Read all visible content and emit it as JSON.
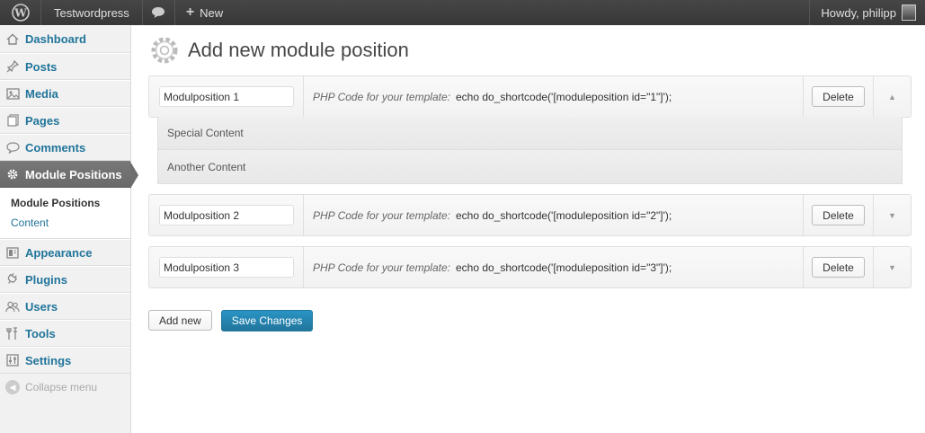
{
  "adminbar": {
    "wp_icon": "wordpress-logo-icon",
    "site_name": "Testwordpress",
    "comments_icon": "speech-bubble-icon",
    "new_icon": "plus-icon",
    "new_label": "New",
    "howdy": "Howdy, philipp"
  },
  "sidebar": {
    "items": [
      {
        "label": "Dashboard",
        "icon": "home-icon"
      },
      {
        "label": "Posts",
        "icon": "pin-icon"
      },
      {
        "label": "Media",
        "icon": "media-icon"
      },
      {
        "label": "Pages",
        "icon": "pages-icon"
      },
      {
        "label": "Comments",
        "icon": "comment-icon"
      },
      {
        "label": "Module Positions",
        "icon": "gear-icon"
      }
    ],
    "submenu": [
      {
        "label": "Module Positions"
      },
      {
        "label": "Content"
      }
    ],
    "items2": [
      {
        "label": "Appearance",
        "icon": "appearance-icon"
      },
      {
        "label": "Plugins",
        "icon": "plugin-icon"
      },
      {
        "label": "Users",
        "icon": "users-icon"
      },
      {
        "label": "Tools",
        "icon": "tools-icon"
      },
      {
        "label": "Settings",
        "icon": "settings-icon"
      }
    ],
    "collapse_label": "Collapse menu"
  },
  "main": {
    "title": "Add new module position",
    "code_label": "PHP Code for your template:",
    "delete_label": "Delete",
    "modules": [
      {
        "name": "Modulposition 1",
        "code": "echo do_shortcode('[moduleposition id=\"1\"]');",
        "expanded": true
      },
      {
        "name": "Modulposition 2",
        "code": "echo do_shortcode('[moduleposition id=\"2\"]');",
        "expanded": false
      },
      {
        "name": "Modulposition 3",
        "code": "echo do_shortcode('[moduleposition id=\"3\"]');",
        "expanded": false
      }
    ],
    "contents": [
      "Special Content",
      "Another Content"
    ],
    "add_new_label": "Add new",
    "save_label": "Save Changes"
  },
  "colors": {
    "link": "#21759b",
    "adminbar": "#464646",
    "primary_button": "#21759b"
  }
}
